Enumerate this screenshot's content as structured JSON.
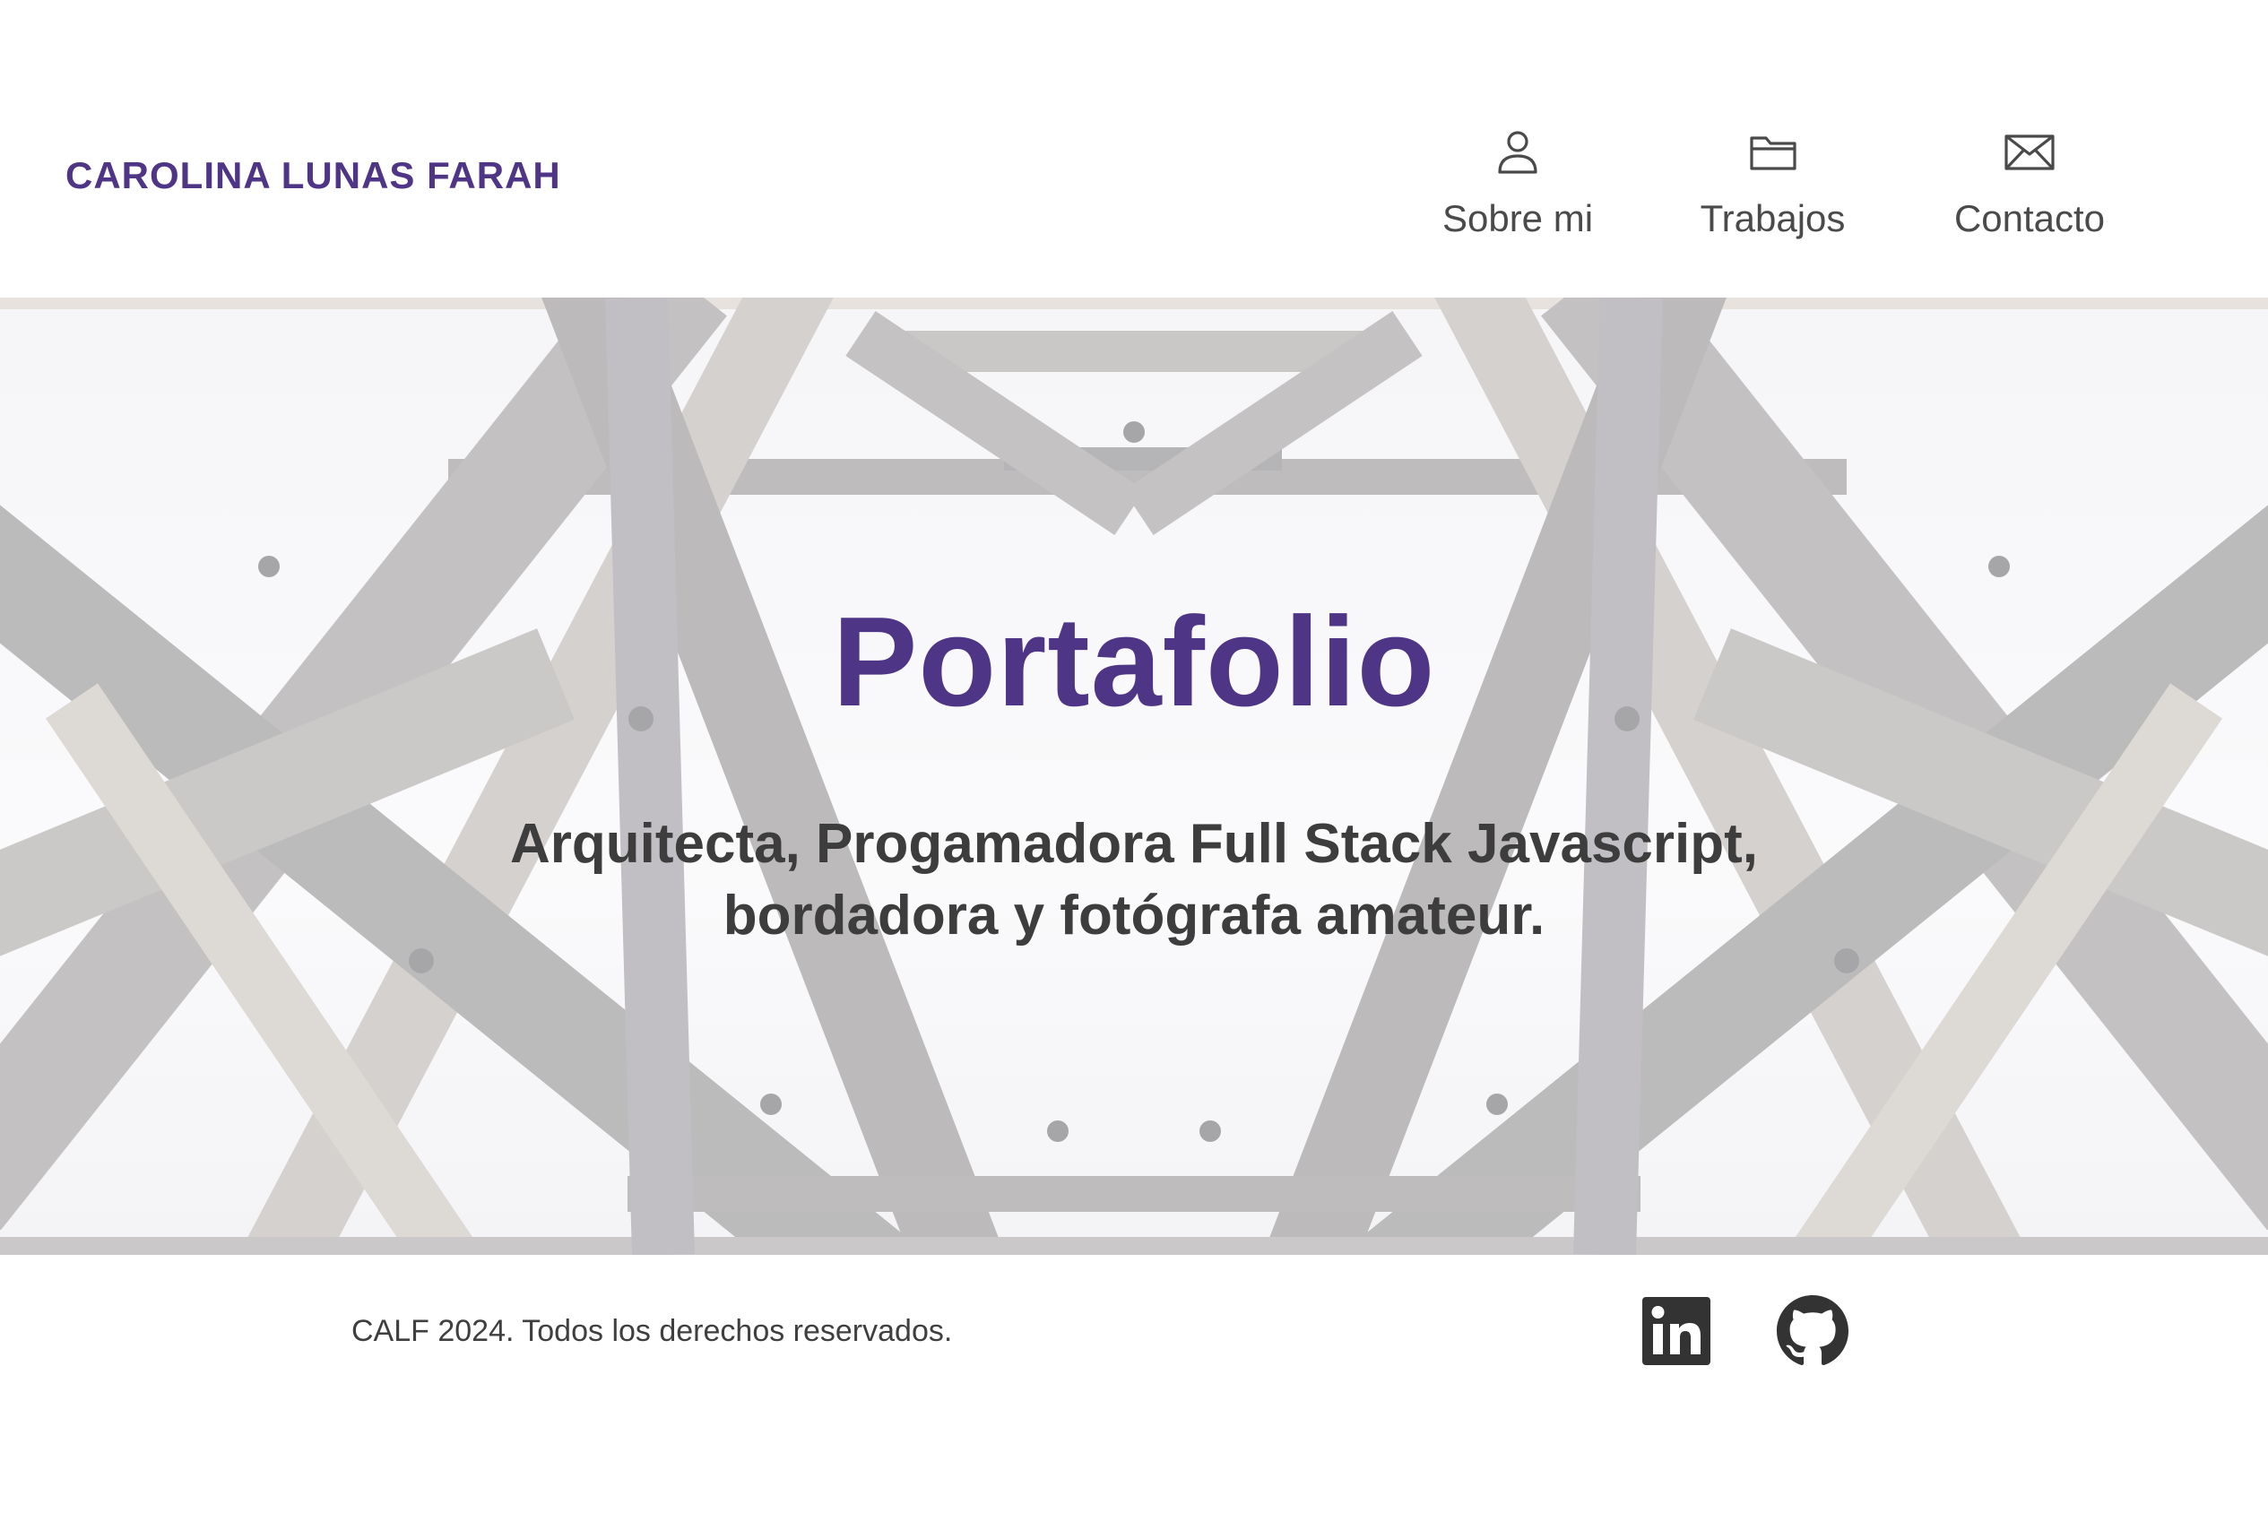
{
  "header": {
    "brand": "CAROLINA LUNAS FARAH",
    "nav": [
      {
        "label": "Sobre mi",
        "icon": "user-icon"
      },
      {
        "label": "Trabajos",
        "icon": "folder-icon"
      },
      {
        "label": "Contacto",
        "icon": "envelope-icon"
      }
    ]
  },
  "hero": {
    "title": "Portafolio",
    "subtitle_line1": "Arquitecta, Progamadora Full Stack Javascript,",
    "subtitle_line2": "bordadora y fotógrafa amateur."
  },
  "footer": {
    "copyright": "CALF 2024. Todos los derechos reservados.",
    "social": [
      {
        "icon": "linkedin-icon"
      },
      {
        "icon": "github-icon"
      }
    ]
  },
  "colors": {
    "accent": "#4f3586",
    "text": "#3d3d3d",
    "nav_text": "#4a4a4a",
    "icon_dark": "#333333"
  }
}
